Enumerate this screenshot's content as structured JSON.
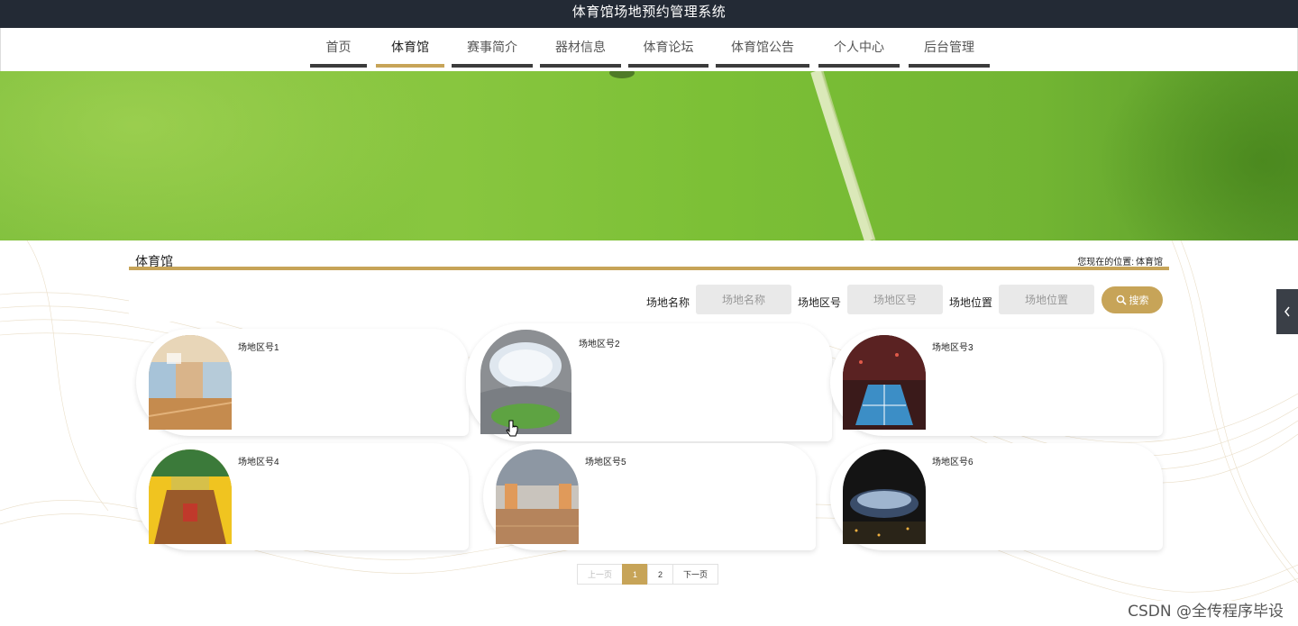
{
  "app": {
    "title": "体育馆场地预约管理系统"
  },
  "nav": {
    "items": [
      {
        "label": "首页",
        "active": false
      },
      {
        "label": "体育馆",
        "active": true
      },
      {
        "label": "赛事简介",
        "active": false
      },
      {
        "label": "器材信息",
        "active": false
      },
      {
        "label": "体育论坛",
        "active": false
      },
      {
        "label": "体育馆公告",
        "active": false
      },
      {
        "label": "个人中心",
        "active": false
      },
      {
        "label": "后台管理",
        "active": false
      }
    ]
  },
  "section": {
    "title": "体育馆",
    "breadcrumb_prefix": "您现在的位置:",
    "breadcrumb_current": "体育馆"
  },
  "search": {
    "name_label": "场地名称",
    "name_placeholder": "场地名称",
    "zone_label": "场地区号",
    "zone_placeholder": "场地区号",
    "location_label": "场地位置",
    "location_placeholder": "场地位置",
    "button_label": "搜索"
  },
  "cards": [
    {
      "name": "场地区号1",
      "image": "indoor-gym-photo"
    },
    {
      "name": "场地区号2",
      "image": "stadium-dome-photo"
    },
    {
      "name": "场地区号3",
      "image": "arena-court-photo"
    },
    {
      "name": "场地区号4",
      "image": "colorful-arena-photo"
    },
    {
      "name": "场地区号5",
      "image": "indoor-hall-photo"
    },
    {
      "name": "场地区号6",
      "image": "stadium-night-photo"
    }
  ],
  "pagination": {
    "prev_label": "上一页",
    "pages": [
      "1",
      "2"
    ],
    "current_page": "1",
    "next_label": "下一页"
  },
  "watermark": "CSDN @全传程序毕设",
  "colors": {
    "accent": "#c7a458",
    "topbar": "#232a35",
    "nav_bar": "#3c3c3c",
    "banner_green": "#7cc036"
  }
}
